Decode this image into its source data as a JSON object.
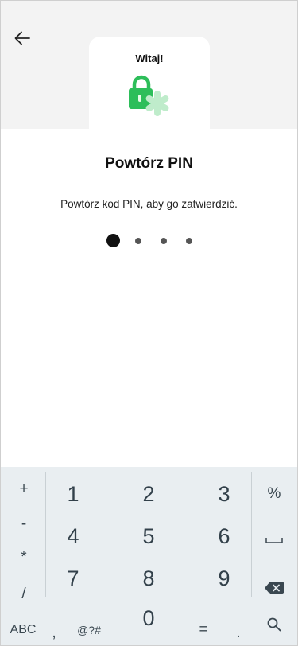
{
  "card": {
    "title": "Witaj!"
  },
  "icons": {
    "back": "arrow-left-icon",
    "lock": "lock-asterisk-icon",
    "backspace": "backspace-icon",
    "search": "search-icon"
  },
  "screen": {
    "heading": "Powtórz PIN",
    "instruction": "Powtórz kod PIN, aby go zatwierdzić.",
    "pin": {
      "length": 4,
      "entered": 0
    }
  },
  "keyboard": {
    "left_symbols": [
      "+",
      "-",
      "*",
      "/"
    ],
    "digits": [
      "1",
      "2",
      "3",
      "4",
      "5",
      "6",
      "7",
      "8",
      "9"
    ],
    "right_symbols": [
      "%",
      "␣"
    ],
    "bottom": {
      "abc": "ABC",
      "comma": ",",
      "symbols": "@?#",
      "zero": "0",
      "equals": "=",
      "period": "."
    }
  },
  "colors": {
    "accent_green": "#2dbe5a",
    "light_green": "#bfeccb",
    "keyboard_bg": "#e9eef1"
  }
}
